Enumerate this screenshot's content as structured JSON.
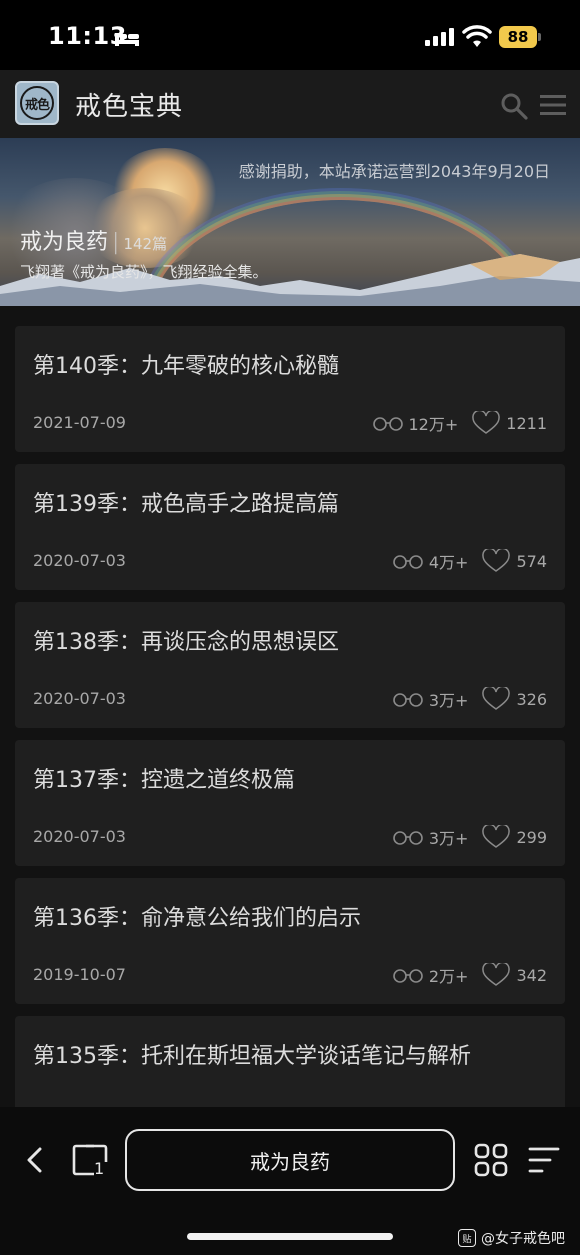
{
  "status": {
    "time": "11:13",
    "battery": "88"
  },
  "header": {
    "logo_text": "戒色",
    "title": "戒色宝典"
  },
  "banner": {
    "notice": "感谢捐助，本站承诺运营到2043年9月20日",
    "title": "戒为良药",
    "separator": "|",
    "count": "142篇",
    "subtitle": "飞翔著《戒为良药》，飞翔经验全集。"
  },
  "articles": [
    {
      "title": "第140季：九年零破的核心秘髓",
      "date": "2021-07-09",
      "views": "12万+",
      "likes": "1211"
    },
    {
      "title": "第139季：戒色高手之路提高篇",
      "date": "2020-07-03",
      "views": "4万+",
      "likes": "574"
    },
    {
      "title": "第138季：再谈压念的思想误区",
      "date": "2020-07-03",
      "views": "3万+",
      "likes": "326"
    },
    {
      "title": "第137季：控遗之道终极篇",
      "date": "2020-07-03",
      "views": "3万+",
      "likes": "299"
    },
    {
      "title": "第136季：俞净意公给我们的启示",
      "date": "2019-10-07",
      "views": "2万+",
      "likes": "342"
    },
    {
      "title": "第135季：托利在斯坦福大学谈话笔记与解析",
      "date": "",
      "views": "",
      "likes": ""
    }
  ],
  "toolbar": {
    "center_label": "戒为良药",
    "tab_count": "1"
  },
  "watermark": {
    "badge": "贴",
    "text": "@女子戒色吧"
  }
}
